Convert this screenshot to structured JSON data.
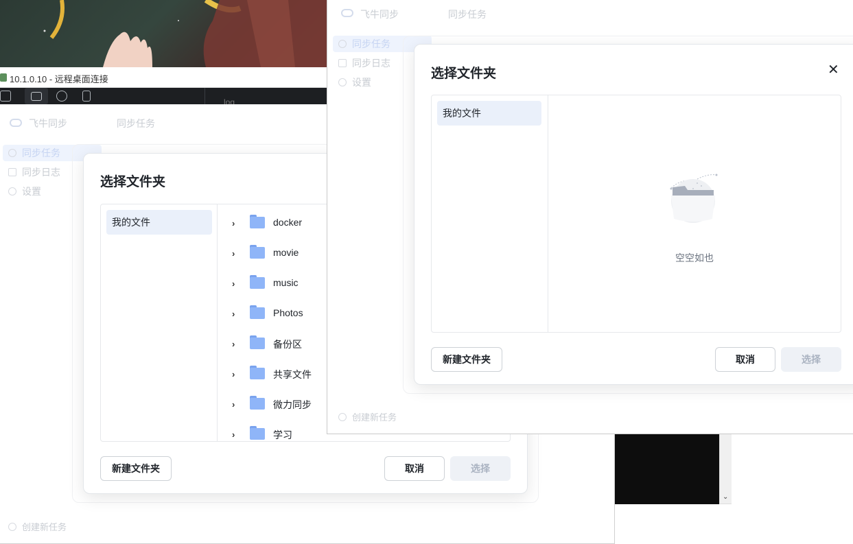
{
  "rdp": {
    "title": "10.1.0.10 - 远程桌面连接",
    "toolbar_text": "log"
  },
  "back_app": {
    "app_name": "飞牛同步",
    "header_title": "同步任务",
    "nav": [
      "同步任务",
      "同步日志",
      "设置"
    ],
    "create_task": "创建新任务",
    "dialog": {
      "title": "选择文件夹",
      "sidebar_item": "我的文件",
      "folders": [
        "docker",
        "movie",
        "music",
        "Photos",
        "备份区",
        "共享文件",
        "微力同步",
        "学习"
      ],
      "new_folder_button": "新建文件夹",
      "cancel_button": "取消",
      "select_button": "选择"
    }
  },
  "front_app": {
    "app_name": "飞牛同步",
    "header_title": "同步任务",
    "nav": [
      "同步任务",
      "同步日志",
      "设置"
    ],
    "create_task": "创建新任务",
    "dialog": {
      "title": "选择文件夹",
      "close_icon": "close-icon",
      "sidebar_item": "我的文件",
      "empty_text": "空空如也",
      "new_folder_button": "新建文件夹",
      "cancel_button": "取消",
      "select_button": "选择"
    }
  },
  "colors": {
    "accent_light": "#eaf0fa",
    "folder_blue": "#8fb5f8",
    "disabled_button_bg": "#eef1f6"
  }
}
